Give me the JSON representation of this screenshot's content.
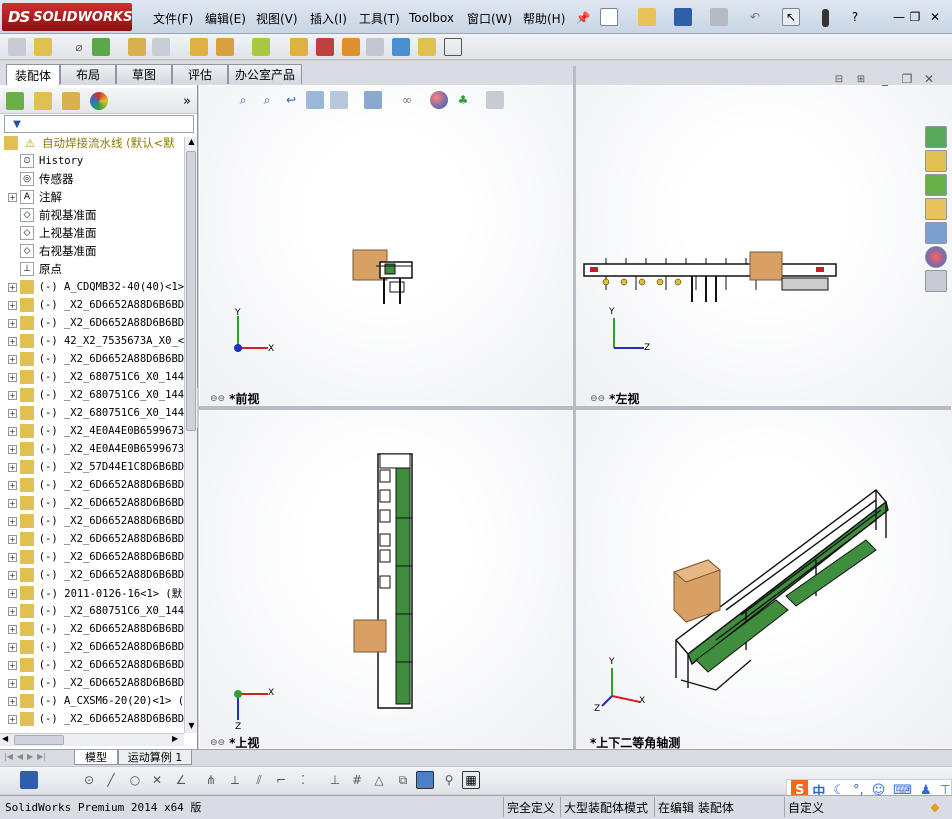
{
  "app": {
    "logo_prefix": "DS",
    "logo_text": "SOLIDWORKS"
  },
  "menu": [
    {
      "label": "文件(F)"
    },
    {
      "label": "编辑(E)"
    },
    {
      "label": "视图(V)"
    },
    {
      "label": "插入(I)"
    },
    {
      "label": "工具(T)"
    },
    {
      "label": "Toolbox"
    },
    {
      "label": "窗口(W)"
    },
    {
      "label": "帮助(H)"
    }
  ],
  "command_tabs": [
    "装配体",
    "布局",
    "草图",
    "评估",
    "办公室产品"
  ],
  "tree": {
    "root": "自动焊接流水线  (默认<默",
    "items": [
      {
        "text": "History",
        "icon": "history-icon",
        "expand": false
      },
      {
        "text": "传感器",
        "icon": "sensor-icon",
        "expand": false
      },
      {
        "text": "注解",
        "icon": "annotation-icon",
        "expand": true
      },
      {
        "text": "前视基准面",
        "icon": "plane-icon",
        "expand": false
      },
      {
        "text": "上视基准面",
        "icon": "plane-icon",
        "expand": false
      },
      {
        "text": "右视基准面",
        "icon": "plane-icon",
        "expand": false
      },
      {
        "text": "原点",
        "icon": "origin-icon",
        "expand": false
      },
      {
        "text": "(-) A_CDQMB32-40(40)<1>",
        "icon": "part-icon",
        "expand": true
      },
      {
        "text": "(-) _X2_6D6652A88D6B6BD",
        "icon": "part-icon",
        "expand": true
      },
      {
        "text": "(-) _X2_6D6652A88D6B6BD",
        "icon": "part-icon",
        "expand": true
      },
      {
        "text": "(-) 42_X2_7535673A_X0_<",
        "icon": "part-icon",
        "expand": true
      },
      {
        "text": "(-) _X2_6D6652A88D6B6BD",
        "icon": "part-icon",
        "expand": true
      },
      {
        "text": "(-) _X2_680751C6_X0_144",
        "icon": "part-icon",
        "expand": true
      },
      {
        "text": "(-) _X2_680751C6_X0_144",
        "icon": "part-icon",
        "expand": true
      },
      {
        "text": "(-) _X2_680751C6_X0_144",
        "icon": "part-icon",
        "expand": true
      },
      {
        "text": "(-) _X2_4E0A4E0B6599673",
        "icon": "part-icon",
        "expand": true
      },
      {
        "text": "(-) _X2_4E0A4E0B6599673",
        "icon": "part-icon",
        "expand": true
      },
      {
        "text": "(-) _X2_57D44E1C8D6B6BD",
        "icon": "part-icon",
        "expand": true
      },
      {
        "text": "(-) _X2_6D6652A88D6B6BD",
        "icon": "part-icon",
        "expand": true
      },
      {
        "text": "(-) _X2_6D6652A88D6B6BD",
        "icon": "part-icon",
        "expand": true
      },
      {
        "text": "(-) _X2_6D6652A88D6B6BD",
        "icon": "part-icon",
        "expand": true
      },
      {
        "text": "(-) _X2_6D6652A88D6B6BD",
        "icon": "part-icon",
        "expand": true
      },
      {
        "text": "(-) _X2_6D6652A88D6B6BD",
        "icon": "part-icon",
        "expand": true
      },
      {
        "text": "(-) _X2_6D6652A88D6B6BD",
        "icon": "part-icon",
        "expand": true
      },
      {
        "text": "(-) 2011-0126-16<1> (默",
        "icon": "part-icon",
        "expand": true
      },
      {
        "text": "(-) _X2_680751C6_X0_144",
        "icon": "part-icon",
        "expand": true
      },
      {
        "text": "(-) _X2_6D6652A88D6B6BD",
        "icon": "part-icon",
        "expand": true
      },
      {
        "text": "(-) _X2_6D6652A88D6B6BD",
        "icon": "part-icon",
        "expand": true
      },
      {
        "text": "(-) _X2_6D6652A88D6B6BD",
        "icon": "part-icon",
        "expand": true
      },
      {
        "text": "(-) _X2_6D6652A88D6B6BD",
        "icon": "part-icon",
        "expand": true
      },
      {
        "text": "(-) A_CXSM6-20(20)<1> (",
        "icon": "part-icon",
        "expand": true
      },
      {
        "text": "(-) _X2_6D6652A88D6B6BD",
        "icon": "part-icon",
        "expand": true
      }
    ]
  },
  "views": {
    "front": "*前视",
    "left": "*左视",
    "top": "*上视",
    "iso": "*上下二等角轴测"
  },
  "axes": {
    "x": "X",
    "y": "Y",
    "z": "Z"
  },
  "bottom_tabs": [
    "模型",
    "运动算例 1"
  ],
  "status": {
    "product": "SolidWorks Premium 2014 x64 版",
    "defined": "完全定义",
    "mode": "大型装配体模式",
    "editing": "在编辑 装配体",
    "custom": "自定义"
  },
  "ime": {
    "lang": "中"
  },
  "colors": {
    "accent": "#c4202a",
    "box": "#d9a066",
    "rail": "#3e8e3e",
    "frame": "#1a1a1a"
  }
}
